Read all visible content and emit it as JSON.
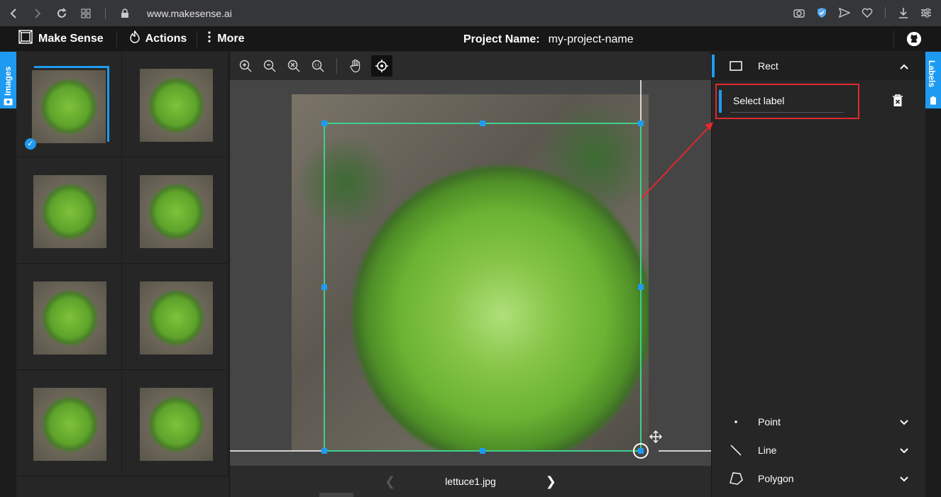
{
  "browser": {
    "url": "www.makesense.ai"
  },
  "app": {
    "brand": "Make Sense",
    "menu": {
      "actions": "Actions",
      "more": "More"
    },
    "project": {
      "label": "Project Name:",
      "name": "my-project-name"
    }
  },
  "left_tab": {
    "label": "Images"
  },
  "right_tab": {
    "label": "Labels"
  },
  "thumbnails": {
    "count": 8,
    "selected_index": 0
  },
  "editor": {
    "filename": "lettuce1.jpg",
    "toolbar": [
      "zoom-in-icon",
      "zoom-out-icon",
      "zoom-fit-icon",
      "zoom-actual-icon",
      "hand-icon",
      "crosshair-icon"
    ],
    "active_tool": "crosshair-icon"
  },
  "label_tools": {
    "rect": "Rect",
    "point": "Point",
    "line": "Line",
    "polygon": "Polygon"
  },
  "label_panel": {
    "select_label": "Select label"
  },
  "colors": {
    "accent": "#1e9bf0",
    "bbox": "#3ecf8e",
    "highlight": "#e0282e"
  }
}
